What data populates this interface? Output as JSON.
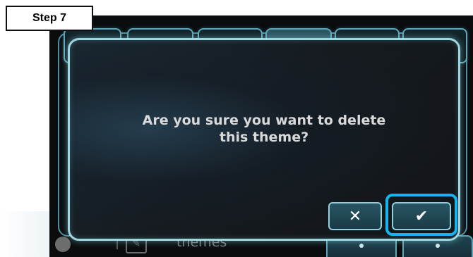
{
  "step": {
    "label": "Step 7"
  },
  "background": {
    "bottom_text": "themes"
  },
  "dialog": {
    "message": "Are you sure you want to delete this theme?",
    "cancel_icon": "close-icon",
    "cancel_glyph": "✕",
    "confirm_icon": "checkmark-icon",
    "confirm_glyph": "✔"
  },
  "colors": {
    "accent": "#9ed7e2",
    "highlight": "#14b4ee",
    "button_fill": "#295564",
    "message_text": "#d9d9d9"
  }
}
